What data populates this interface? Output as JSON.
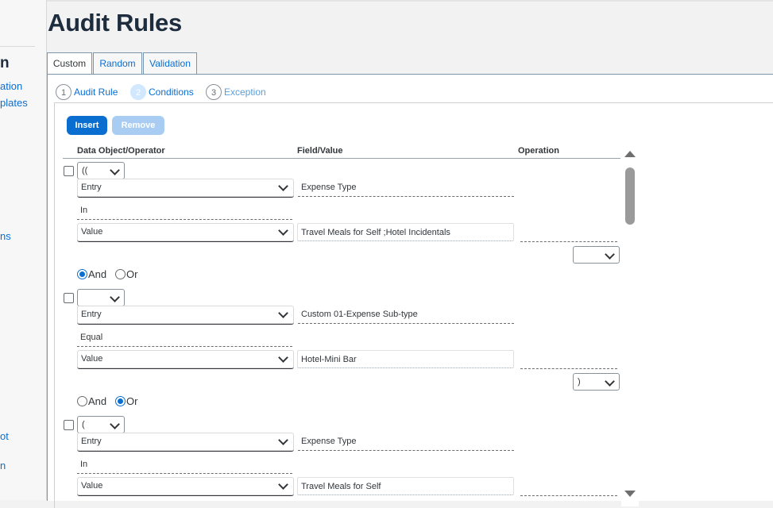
{
  "title": "Audit Rules",
  "left_nav": {
    "heading": "n",
    "links": [
      "ation",
      "plates",
      "ns",
      "ot",
      "n"
    ]
  },
  "tabs": [
    "Custom",
    "Random",
    "Validation"
  ],
  "steps": [
    {
      "num": "1",
      "label": "Audit Rule"
    },
    {
      "num": "2",
      "label": "Conditions"
    },
    {
      "num": "3",
      "label": "Exception"
    }
  ],
  "buttons": {
    "insert": "Insert",
    "remove": "Remove"
  },
  "columns": {
    "data_object": "Data Object/Operator",
    "field_value": "Field/Value",
    "operation": "Operation"
  },
  "logic": {
    "and": "And",
    "or": "Or"
  },
  "conditions": [
    {
      "open_paren": "((",
      "object": "Entry",
      "field": "Expense Type",
      "operator": "In",
      "value_type": "Value",
      "value": "Travel Meals for Self ;Hotel Incidentals",
      "close_paren": ""
    },
    {
      "open_paren": "",
      "object": "Entry",
      "field": "Custom 01-Expense Sub-type",
      "operator": "Equal",
      "value_type": "Value",
      "value": "Hotel-Mini Bar",
      "close_paren": ")"
    },
    {
      "open_paren": "(",
      "object": "Entry",
      "field": "Expense Type",
      "operator": "In",
      "value_type": "Value",
      "value": "Travel Meals for Self",
      "close_paren": ""
    }
  ]
}
